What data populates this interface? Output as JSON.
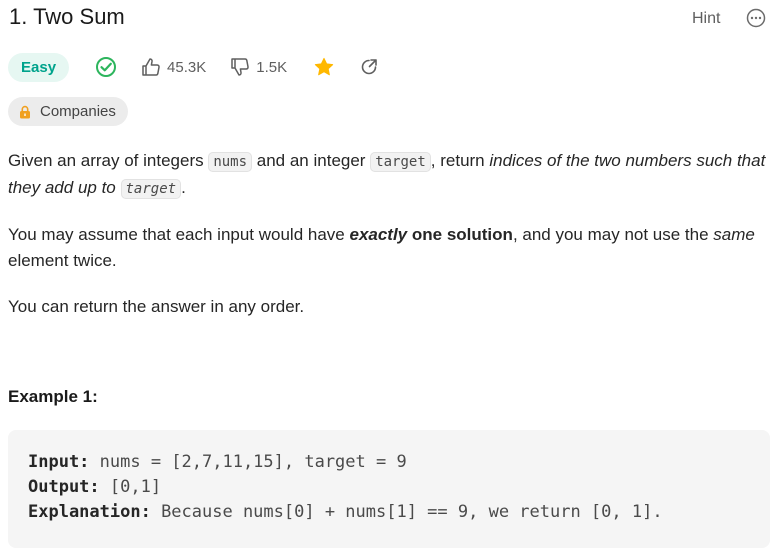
{
  "problem": {
    "title": "1. Two Sum",
    "hint_label": "Hint",
    "difficulty": "Easy",
    "likes": "45.3K",
    "dislikes": "1.5K",
    "companies_label": "Companies"
  },
  "description": {
    "p1": {
      "t1": "Given an array of integers ",
      "code1": "nums",
      "t2": " and an integer ",
      "code2": "target",
      "t3": ", return ",
      "em1": "indices of the two numbers such that they add up to",
      "t4": " ",
      "code3": "target",
      "t5": "."
    },
    "p2": {
      "t1": "You may assume that each input would have ",
      "b1": "exactly",
      "b2": " one solution",
      "t2": ", and you may not use the ",
      "em1": "same",
      "t3": " element twice."
    },
    "p3": "You can return the answer in any order."
  },
  "example": {
    "title": "Example 1:",
    "input_label": "Input:",
    "input_value": " nums = [2,7,11,15], target = 9",
    "output_label": "Output:",
    "output_value": " [0,1]",
    "explanation_label": "Explanation:",
    "explanation_value": " Because nums[0] + nums[1] == 9, we return [0, 1]."
  },
  "colors": {
    "easy_text": "#00a38c",
    "easy_bg": "#e6f7f2",
    "star": "#ffb800",
    "lock": "#f0a020"
  }
}
